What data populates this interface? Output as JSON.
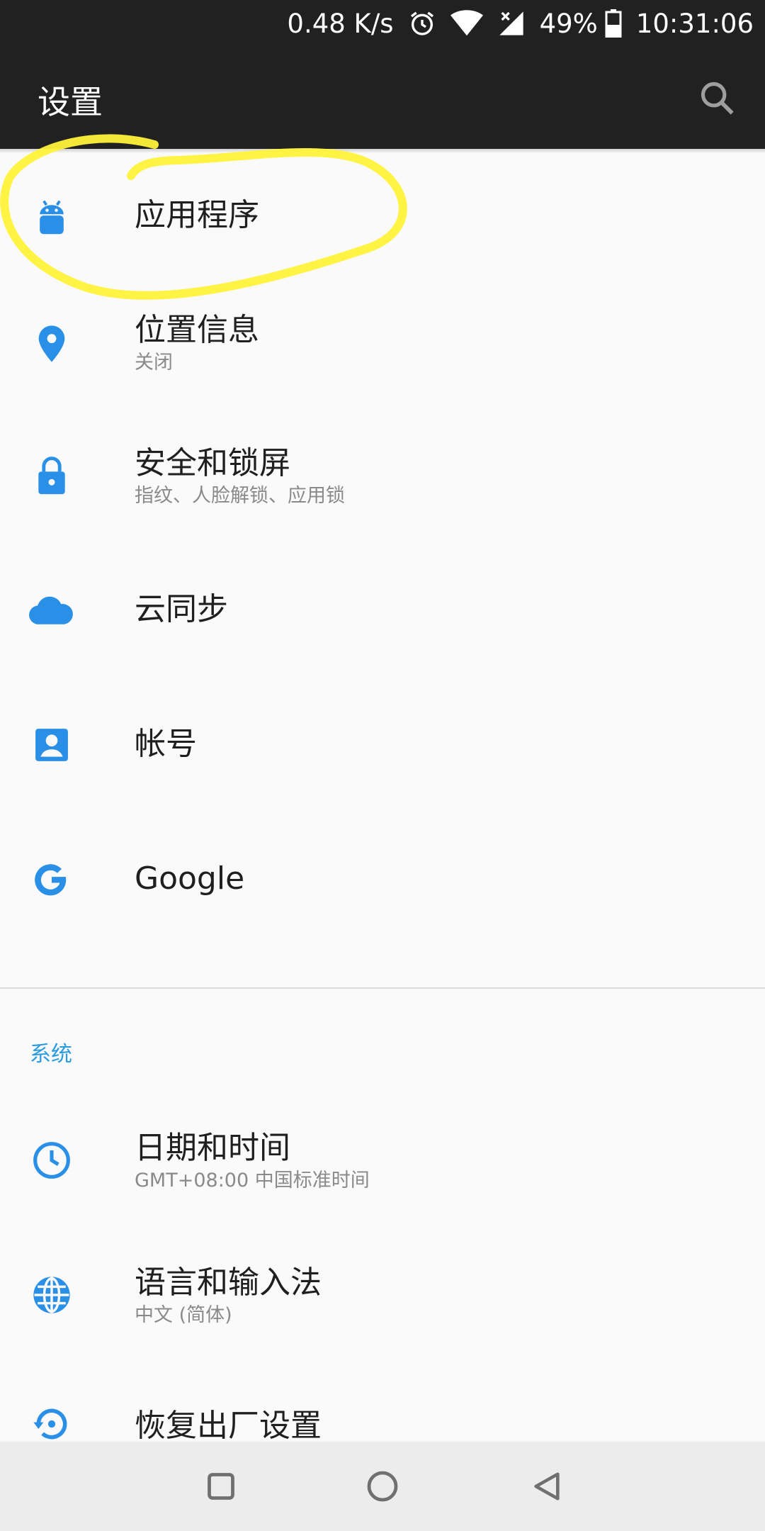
{
  "status_bar": {
    "net_speed": "0.48 K/s",
    "battery": "49%",
    "time": "10:31:06",
    "icons": [
      "alarm-icon",
      "wifi-icon",
      "cellular-no-signal-icon",
      "battery-icon"
    ]
  },
  "app_bar": {
    "title": "设置",
    "search_icon": "search-icon"
  },
  "list": {
    "items": [
      {
        "title": "应用程序",
        "subtitle": "",
        "icon": "android-icon"
      },
      {
        "title": "位置信息",
        "subtitle": "关闭",
        "icon": "location-pin-icon"
      },
      {
        "title": "安全和锁屏",
        "subtitle": "指纹、人脸解锁、应用锁",
        "icon": "lock-icon"
      },
      {
        "title": "云同步",
        "subtitle": "",
        "icon": "cloud-icon"
      },
      {
        "title": "帐号",
        "subtitle": "",
        "icon": "account-icon"
      },
      {
        "title": "Google",
        "subtitle": "",
        "icon": "google-icon"
      }
    ],
    "section_header": "系统",
    "system_items": [
      {
        "title": "日期和时间",
        "subtitle": "GMT+08:00 中国标准时间",
        "icon": "clock-icon"
      },
      {
        "title": "语言和输入法",
        "subtitle": "中文 (简体)",
        "icon": "globe-icon"
      },
      {
        "title": "恢复出厂设置",
        "subtitle": "",
        "icon": "restore-icon"
      }
    ]
  },
  "nav_bar": {
    "buttons": [
      "recents-button",
      "home-button",
      "back-button"
    ]
  },
  "colors": {
    "accent": "#2b9be0",
    "icon_blue": "#2a8fe6",
    "app_bar": "#212121",
    "highlight": "#fff23a"
  }
}
